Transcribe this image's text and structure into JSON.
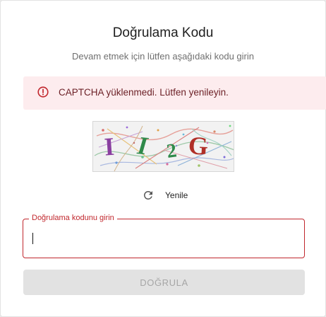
{
  "dialog": {
    "title": "Doğrulama Kodu",
    "subtitle": "Devam etmek için lütfen aşağıdaki kodu girin"
  },
  "alert": {
    "icon": "error-circle-icon",
    "message": "CAPTCHA yüklenmedi. Lütfen yenileyin.",
    "color": "#c1272d",
    "background": "#fdecee"
  },
  "captcha": {
    "characters": [
      "I",
      "I",
      "2",
      "G"
    ],
    "colors": [
      "#8a3fa0",
      "#2f8a4a",
      "#2f8a4a",
      "#b03028"
    ]
  },
  "refresh": {
    "icon": "refresh-icon",
    "label": "Yenile"
  },
  "code_field": {
    "label": "Doğrulama kodunu girin",
    "value": "",
    "border_color": "#c1272d"
  },
  "verify_button": {
    "label": "DOĞRULA",
    "disabled": true
  }
}
